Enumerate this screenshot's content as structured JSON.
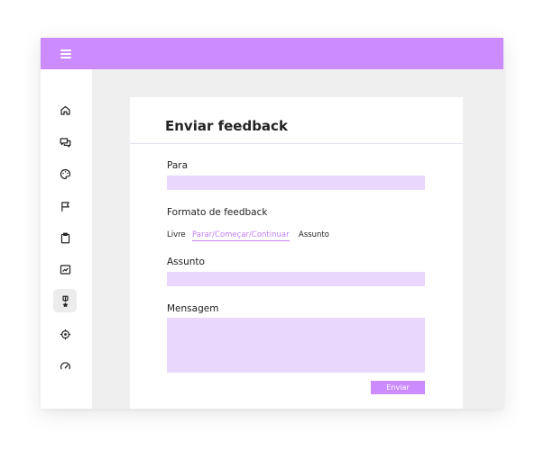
{
  "header": {
    "menu_icon": "hamburger-icon",
    "accent_color": "#cc8cff"
  },
  "sidebar": {
    "items": [
      {
        "icon": "home-icon",
        "active": false
      },
      {
        "icon": "chat-icon",
        "active": false
      },
      {
        "icon": "palette-icon",
        "active": false
      },
      {
        "icon": "flag-icon",
        "active": false
      },
      {
        "icon": "clipboard-icon",
        "active": false
      },
      {
        "icon": "chart-icon",
        "active": false
      },
      {
        "icon": "award-icon",
        "active": true
      },
      {
        "icon": "target-icon",
        "active": false
      },
      {
        "icon": "gauge-icon",
        "active": false
      }
    ]
  },
  "form": {
    "title": "Enviar feedback",
    "to_label": "Para",
    "to_value": "",
    "format_label": "Formato de feedback",
    "format_options": [
      "Livre",
      "Parar/Começar/Continuar",
      "Assunto"
    ],
    "format_selected": "Parar/Começar/Continuar",
    "subject_label": "Assunto",
    "subject_value": "",
    "message_label": "Mensagem",
    "message_value": "",
    "submit_label": "Enviar",
    "field_color": "#ead7fd"
  }
}
